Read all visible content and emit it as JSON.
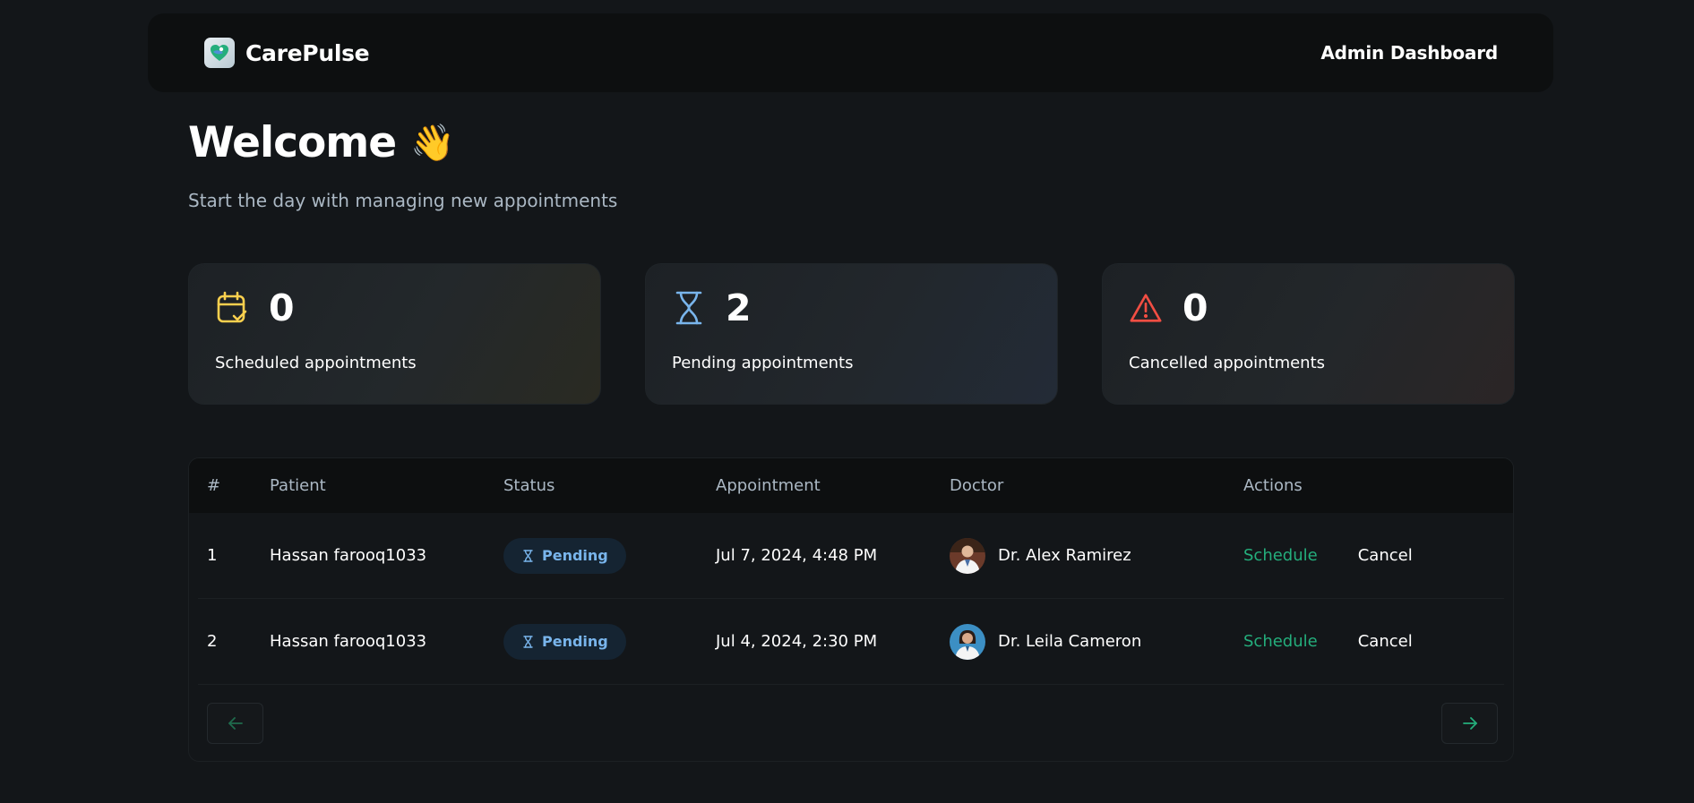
{
  "header": {
    "logo_text": "CarePulse",
    "title": "Admin Dashboard"
  },
  "welcome": {
    "title": "Welcome",
    "emoji": "👋",
    "subtitle": "Start the day with managing new appointments"
  },
  "stats": [
    {
      "count": "0",
      "label": "Scheduled appointments",
      "icon": "calendar-check-icon",
      "color": "#fbd04e"
    },
    {
      "count": "2",
      "label": "Pending appointments",
      "icon": "hourglass-icon",
      "color": "#79b5ec"
    },
    {
      "count": "0",
      "label": "Cancelled appointments",
      "icon": "alert-triangle-icon",
      "color": "#f24e43"
    }
  ],
  "table": {
    "headers": {
      "num": "#",
      "patient": "Patient",
      "status": "Status",
      "appointment": "Appointment",
      "doctor": "Doctor",
      "actions": "Actions"
    },
    "rows": [
      {
        "num": "1",
        "patient": "Hassan farooq1033",
        "status": "Pending",
        "appointment": "Jul 7, 2024, 4:48 PM",
        "doctor": "Dr. Alex Ramirez",
        "schedule": "Schedule",
        "cancel": "Cancel"
      },
      {
        "num": "2",
        "patient": "Hassan farooq1033",
        "status": "Pending",
        "appointment": "Jul 4, 2024, 2:30 PM",
        "doctor": "Dr. Leila Cameron",
        "schedule": "Schedule",
        "cancel": "Cancel"
      }
    ]
  },
  "colors": {
    "accent_green": "#24ae7c",
    "pending_blue": "#79b5ec",
    "background": "#131619"
  }
}
